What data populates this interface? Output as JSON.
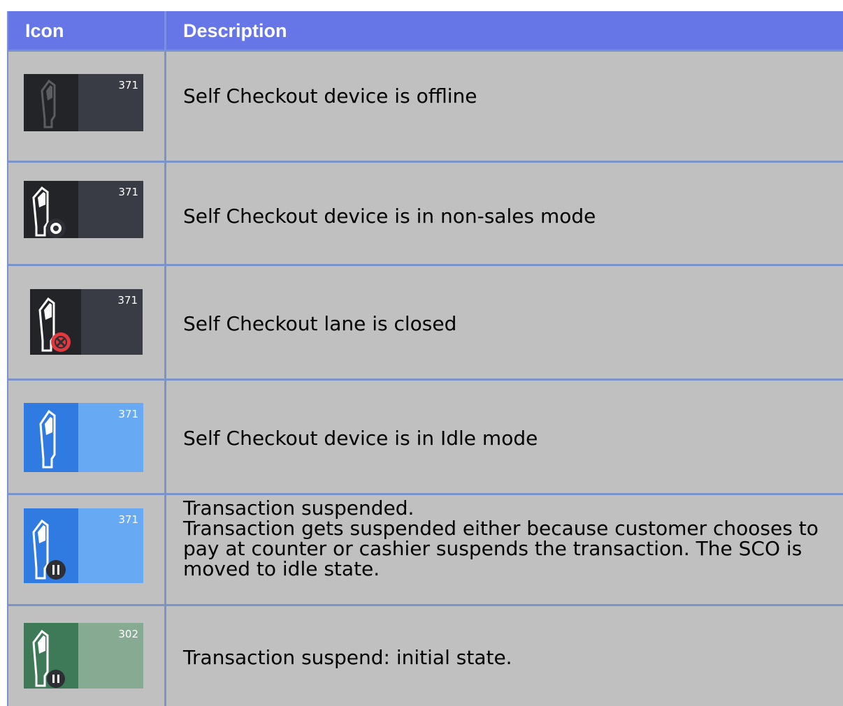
{
  "table": {
    "header": {
      "icon": "Icon",
      "description": "Description"
    },
    "rows": [
      {
        "number": "371",
        "description": "Self Checkout device is offline",
        "icon": "kiosk-offline-icon",
        "colors": {
          "left": "#232427",
          "right": "#393b45",
          "kiosk": "#5c5d60"
        }
      },
      {
        "number": "371",
        "description": "Self Checkout device is in non-sales mode",
        "icon": "kiosk-gear-icon",
        "colors": {
          "left": "#232427",
          "right": "#393b45",
          "kiosk": "#ffffff"
        }
      },
      {
        "number": "371",
        "description": "Self Checkout lane is closed",
        "icon": "kiosk-closed-icon",
        "colors": {
          "left": "#232427",
          "right": "#393b45",
          "kiosk": "#ffffff",
          "badge": "#e0393e"
        }
      },
      {
        "number": "371",
        "description": "Self Checkout device is in Idle mode",
        "icon": "kiosk-idle-icon",
        "colors": {
          "left": "#2f7be2",
          "right": "#67aaf3",
          "kiosk": "#ffffff"
        }
      },
      {
        "number": "371",
        "description": "Transaction suspended.\nTransaction gets suspended either because customer chooses to pay at counter or cashier suspends the transaction. The SCO is moved to idle state.",
        "icon": "kiosk-suspended-icon",
        "colors": {
          "left": "#2f7be2",
          "right": "#67aaf3",
          "kiosk": "#ffffff",
          "badge": "#2d2f35"
        }
      },
      {
        "number": "302",
        "description": "Transaction suspend: initial state.",
        "icon": "kiosk-suspend-initial-icon",
        "colors": {
          "left": "#3e7a57",
          "right": "#87ab92",
          "kiosk": "#ffffff",
          "badge": "#2d2f35"
        }
      }
    ]
  }
}
